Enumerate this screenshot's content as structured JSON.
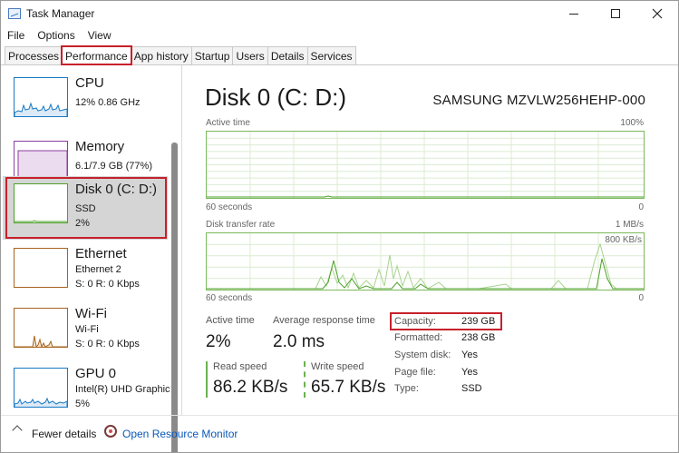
{
  "window": {
    "title": "Task Manager",
    "minimize": "minimize",
    "maximize": "maximize",
    "close": "close"
  },
  "menu": [
    "File",
    "Options",
    "View"
  ],
  "tabs": [
    "Processes",
    "Performance",
    "App history",
    "Startup",
    "Users",
    "Details",
    "Services"
  ],
  "active_tab": "Performance",
  "sidebar": [
    {
      "name": "CPU",
      "line1": "12%  0.86 GHz",
      "color": "#1779c4"
    },
    {
      "name": "Memory",
      "line1": "6.1/7.9 GB (77%)",
      "color": "#8b3f9e"
    },
    {
      "name": "Disk 0 (C: D:)",
      "line1": "SSD",
      "line2": "2%",
      "color": "#4da02a"
    },
    {
      "name": "Ethernet",
      "line1": "Ethernet 2",
      "line2": "S: 0 R: 0 Kbps",
      "color": "#a8641f"
    },
    {
      "name": "Wi-Fi",
      "line1": "Wi-Fi",
      "line2": "S: 0 R: 0 Kbps",
      "color": "#a8641f"
    },
    {
      "name": "GPU 0",
      "line1": "Intel(R) UHD Graphic",
      "line2": "5%",
      "color": "#1779c4"
    }
  ],
  "main": {
    "title": "Disk 0 (C: D:)",
    "model": "SAMSUNG MZVLW256HEHP-000",
    "active_time_graph": {
      "label": "Active time",
      "max": "100%",
      "time": "60 seconds",
      "min": "0"
    },
    "transfer_graph": {
      "label": "Disk transfer rate",
      "max": "1 MB/s",
      "mid": "800 KB/s",
      "time": "60 seconds",
      "min": "0"
    },
    "stats": {
      "active_time_label": "Active time",
      "active_time": "2%",
      "response_label": "Average response time",
      "response": "2.0 ms",
      "read_label": "Read speed",
      "read": "86.2 KB/s",
      "write_label": "Write speed",
      "write": "65.7 KB/s"
    },
    "properties": [
      {
        "label": "Capacity:",
        "value": "239 GB"
      },
      {
        "label": "Formatted:",
        "value": "238 GB"
      },
      {
        "label": "System disk:",
        "value": "Yes"
      },
      {
        "label": "Page file:",
        "value": "Yes"
      },
      {
        "label": "Type:",
        "value": "SSD"
      }
    ]
  },
  "footer": {
    "fewer_details": "Fewer details",
    "resource_monitor": "Open Resource Monitor"
  },
  "colors": {
    "accent_red": "#c8202b",
    "disk_green": "#4da02a",
    "link_blue": "#0a58b8"
  }
}
